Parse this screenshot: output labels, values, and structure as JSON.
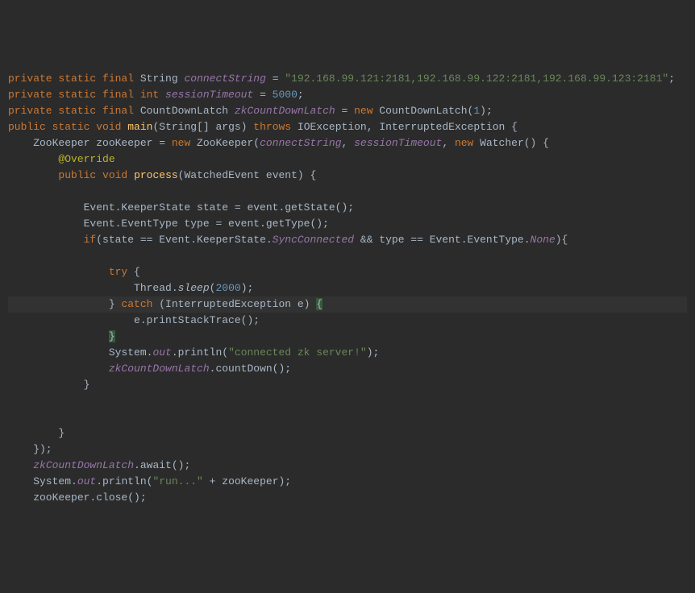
{
  "code": {
    "l1": {
      "kw1": "private static final",
      "type": "String",
      "field": "connectString",
      "eq": " = ",
      "str": "\"192.168.99.121:2181,192.168.99.122:2181,192.168.99.123:2181\"",
      "semi": ";"
    },
    "l2": {
      "kw1": "private static final int",
      "field": "sessionTimeout",
      "eq": " = ",
      "num": "5000",
      "semi": ";"
    },
    "l3": {
      "kw1": "private static final",
      "type": " CountDownLatch ",
      "field": "zkCountDownLatch",
      "eq": " = ",
      "kw2": "new",
      "ctor": " CountDownLatch(",
      "num": "1",
      "close": ");"
    },
    "l4": {
      "kw1": "public static void",
      "method": "main",
      "params": "(String[] args) ",
      "kw2": "throws",
      "exc": " IOException, InterruptedException {"
    },
    "l5": {
      "pre": "    ZooKeeper zooKeeper = ",
      "kw1": "new",
      "ctor": " ZooKeeper(",
      "f1": "connectString",
      "c1": ", ",
      "f2": "sessionTimeout",
      "c2": ", ",
      "kw2": "new",
      "tail": " Watcher() {"
    },
    "l6": {
      "pre": "        ",
      "ann": "@Override"
    },
    "l7": {
      "pre": "        ",
      "kw1": "public void",
      "method": "process",
      "params": "(WatchedEvent event) {"
    },
    "l8": {
      "blank": ""
    },
    "l9": {
      "text": "            Event.KeeperState state = event.getState();"
    },
    "l10": {
      "text": "            Event.EventType type = event.getType();"
    },
    "l11": {
      "pre": "            ",
      "kw": "if",
      "p1": "(state == Event.KeeperState.",
      "enum1": "SyncConnected",
      "p2": " && type == Event.EventType.",
      "enum2": "None",
      "p3": "){"
    },
    "l12": {
      "blank": ""
    },
    "l13": {
      "pre": "                ",
      "kw": "try",
      "tail": " {"
    },
    "l14": {
      "pre": "                    Thread.",
      "m": "sleep",
      "p1": "(",
      "num": "2000",
      "p2": ");"
    },
    "l15": {
      "pre": "                } ",
      "kw": "catch",
      "params": " (InterruptedException e) ",
      "brace": "{"
    },
    "l16": {
      "text": "                    e.printStackTrace();"
    },
    "l17": {
      "pre": "                ",
      "brace": "}"
    },
    "l18": {
      "pre": "                System.",
      "out": "out",
      "p1": ".println(",
      "str": "\"connected zk server!\"",
      "p2": ");"
    },
    "l19": {
      "pre": "                ",
      "f": "zkCountDownLatch",
      "tail": ".countDown();"
    },
    "l20": {
      "text": "            }"
    },
    "l21": {
      "blank": ""
    },
    "l22": {
      "blank": ""
    },
    "l23": {
      "text": "        }"
    },
    "l24": {
      "text": "    });"
    },
    "l25": {
      "pre": "    ",
      "f": "zkCountDownLatch",
      "tail": ".await();"
    },
    "l26": {
      "pre": "    System.",
      "out": "out",
      "p1": ".println(",
      "str": "\"run...\"",
      "p2": " + zooKeeper);"
    },
    "l27": {
      "text": "    zooKeeper.close();"
    }
  }
}
